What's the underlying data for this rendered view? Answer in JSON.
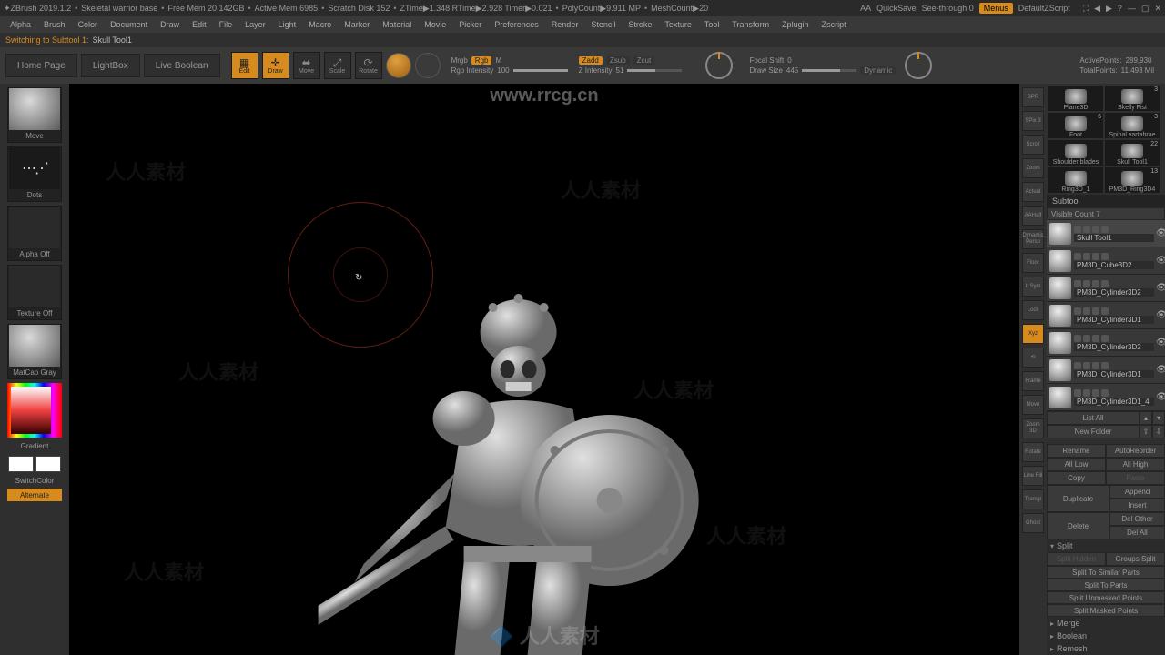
{
  "titlebar": {
    "app": "ZBrush 2019.1.2",
    "project": "Skeletal warrior base",
    "freemem": "Free Mem 20.142GB",
    "activemem": "Active Mem 6985",
    "scratch": "Scratch Disk 152",
    "ztime": "ZTime▶1.348 RTime▶2.928 Timer▶0.021",
    "polycount": "PolyCount▶9.911 MP",
    "meshcount": "MeshCount▶20",
    "aa": "AA",
    "quicksave": "QuickSave",
    "seethrough": "See-through  0",
    "menus": "Menus",
    "defaultzscript": "DefaultZScript"
  },
  "menubar": [
    "Alpha",
    "Brush",
    "Color",
    "Document",
    "Draw",
    "Edit",
    "File",
    "Layer",
    "Light",
    "Macro",
    "Marker",
    "Material",
    "Movie",
    "Picker",
    "Preferences",
    "Render",
    "Stencil",
    "Stroke",
    "Texture",
    "Tool",
    "Transform",
    "Zplugin",
    "Zscript"
  ],
  "statusline": {
    "msg": "Switching to Subtool 1:",
    "tool": "Skull Tool1"
  },
  "shelf": {
    "home": "Home Page",
    "lightbox": "LightBox",
    "live": "Live Boolean",
    "tools": [
      "Edit",
      "Draw",
      "Move",
      "Scale",
      "Rotate"
    ],
    "mrgb": {
      "label": "Mrgb",
      "rgb": "Rgb",
      "m": "M",
      "rgbint": "Rgb Intensity",
      "rgbv": "100"
    },
    "zadd": {
      "label": "Zadd",
      "zsub": "Zsub",
      "zcut": "Zcut",
      "zint": "Z Intensity",
      "zv": "51"
    },
    "focal": {
      "label": "Focal Shift",
      "v": "0"
    },
    "draw": {
      "label": "Draw Size",
      "v": "445",
      "dyn": "Dynamic"
    },
    "active": {
      "label": "ActivePoints:",
      "v": "289,930"
    },
    "total": {
      "label": "TotalPoints:",
      "v": "11.493 Mil"
    }
  },
  "left": {
    "move": "Move",
    "dots": "Dots",
    "alpha": "Alpha Off",
    "texture": "Texture Off",
    "matcap": "MatCap Gray",
    "gradient": "Gradient",
    "switch": "SwitchColor",
    "alt": "Alternate"
  },
  "rightbar": [
    "BPR",
    "SPix 3",
    "Scroll",
    "Zoom",
    "Actual",
    "AAHalf",
    "Dynamic Persp",
    "Floor",
    "L.Sym",
    "Lock",
    "Xyz",
    "⟲",
    "Frame",
    "Move",
    "Zoom 3D",
    "Rotate",
    "Line Fill",
    "Transp",
    "Ghost"
  ],
  "rightbar_on": {
    "BPR": false,
    "Xyz": true
  },
  "toolpanel": {
    "thumbs": [
      {
        "n": "Plane3D",
        "c": ""
      },
      {
        "n": "Skelly Fist",
        "c": "3"
      },
      {
        "n": "Foot",
        "c": "6"
      },
      {
        "n": "Spinal vartabrae",
        "c": "3"
      },
      {
        "n": "Shoulder blades",
        "c": ""
      },
      {
        "n": "Skull Tool1",
        "c": "22"
      },
      {
        "n": "Ring3D_1",
        "c": ""
      },
      {
        "n": "PM3D_Ring3D4",
        "c": "13"
      }
    ],
    "subtool_hdr": "Subtool",
    "viscount": "Visible Count 7",
    "subtools": [
      {
        "n": "Skull Tool1",
        "sel": true
      },
      {
        "n": "PM3D_Cube3D2"
      },
      {
        "n": "PM3D_Cylinder3D2"
      },
      {
        "n": "PM3D_Cylinder3D1"
      },
      {
        "n": "PM3D_Cylinder3D2"
      },
      {
        "n": "PM3D_Cylinder3D1"
      },
      {
        "n": "PM3D_Cylinder3D1_4"
      }
    ],
    "btns": {
      "listall": "List All",
      "newfolder": "New Folder",
      "rename": "Rename",
      "autoreorder": "AutoReorder",
      "alllow": "All Low",
      "allhigh": "All High",
      "copy": "Copy",
      "paste": "Paste",
      "duplicate": "Duplicate",
      "append": "Append",
      "insert": "Insert",
      "delete": "Delete",
      "delother": "Del Other",
      "delall": "Del All",
      "split": "Split",
      "splithidden": "Split Hidden",
      "groupssplit": "Groups Split",
      "splitsimilar": "Split To Similar Parts",
      "splitparts": "Split To Parts",
      "splitunmasked": "Split Unmasked Points",
      "splitmasked": "Split Masked Points",
      "merge": "Merge",
      "boolean": "Boolean",
      "remesh": "Remesh"
    }
  },
  "watermark": {
    "url": "www.rrcg.cn",
    "body": "人人素材",
    "logo": "🔷 人人素材"
  }
}
